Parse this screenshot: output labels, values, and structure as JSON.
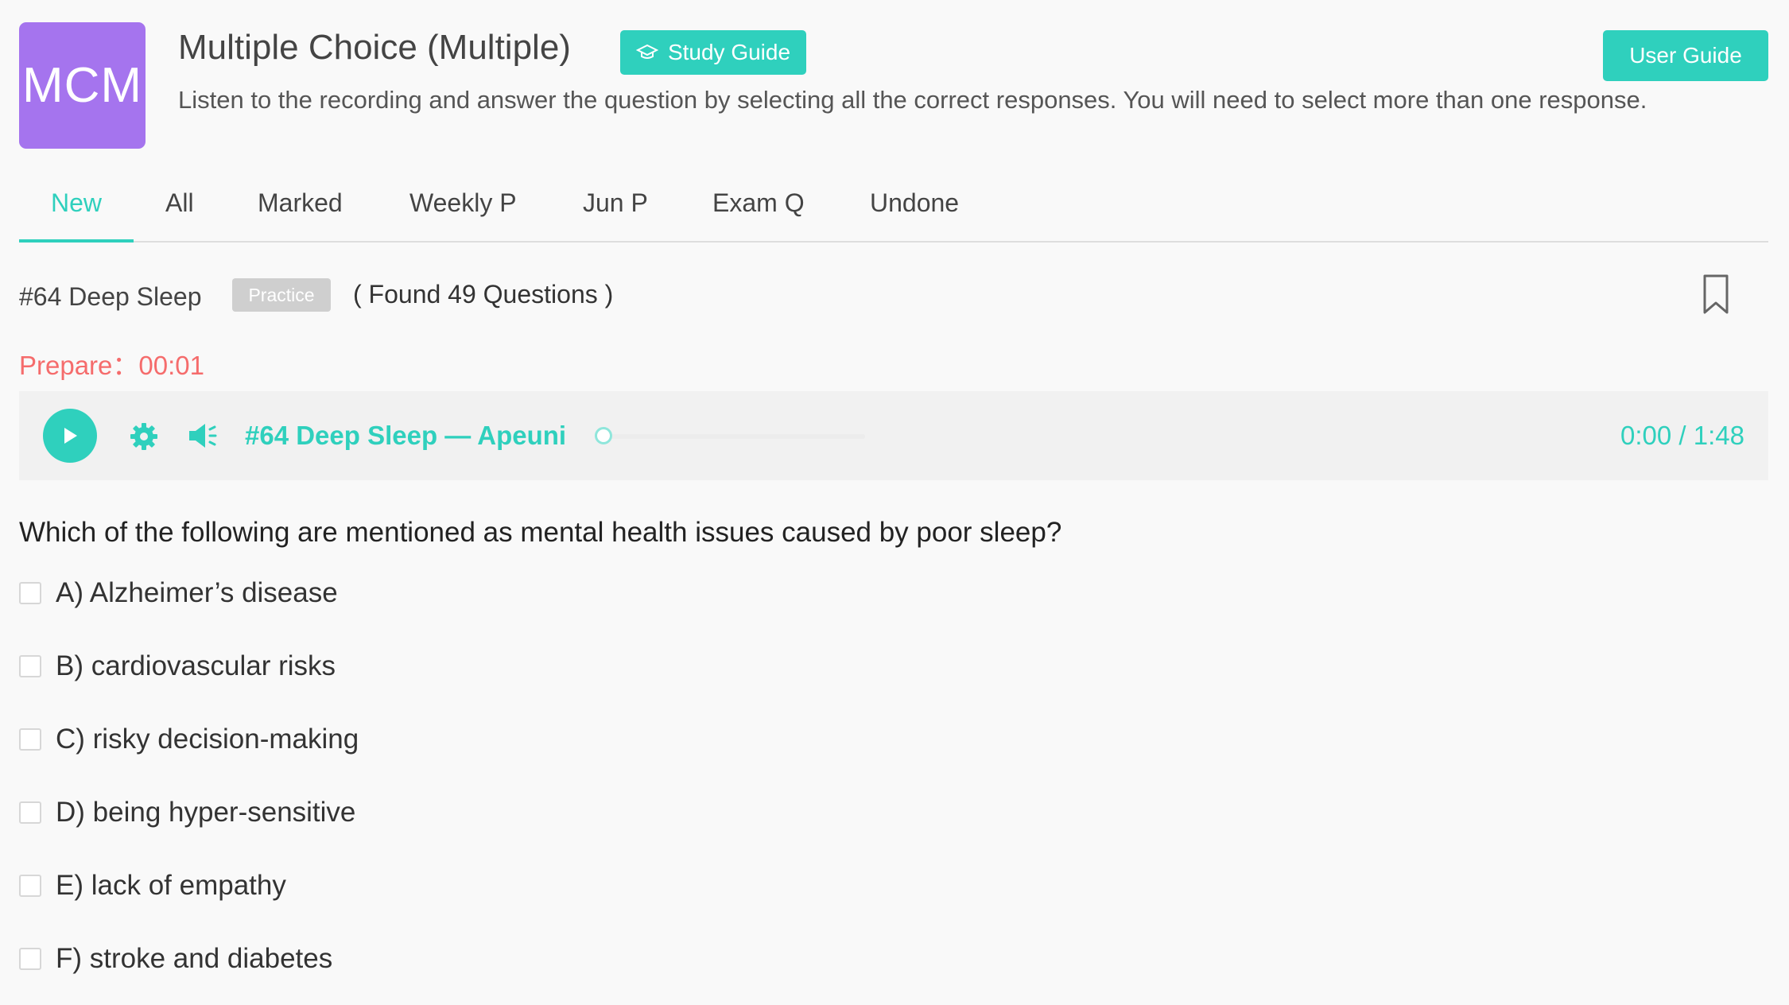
{
  "logo": {
    "text": "MCM"
  },
  "header": {
    "title": "Multiple Choice (Multiple)",
    "study_guide_label": "Study Guide",
    "user_guide_label": "User Guide",
    "description": "Listen to the recording and answer the question by selecting all the correct responses. You will need to select more than one response."
  },
  "tabs": [
    "New",
    "All",
    "Marked",
    "Weekly P",
    "Jun P",
    "Exam Q",
    "Undone"
  ],
  "active_tab": "New",
  "question_header": {
    "title": "#64 Deep Sleep",
    "badge": "Practice",
    "found": "( Found 49 Questions )"
  },
  "prepare": {
    "label": "Prepare：",
    "time": "00:01"
  },
  "player": {
    "track_title": "#64 Deep Sleep — Apeuni",
    "time": "0:00 / 1:48",
    "progress": 0
  },
  "question": "Which of the following are mentioned as mental health issues caused by poor sleep?",
  "options": [
    "A) Alzheimer’s disease",
    "B) cardiovascular risks",
    "C) risky decision-making",
    "D) being hyper-sensitive",
    "E) lack of empathy",
    "F) stroke and diabetes"
  ],
  "colors": {
    "accent": "#2fd0bd",
    "logo_bg": "#a574ee",
    "prepare": "#f56c6c",
    "badge_bg": "#cfcfcf"
  },
  "icons": {
    "study_guide": "graduation-cap-icon",
    "bookmark": "bookmark-icon",
    "play": "play-icon",
    "settings": "gear-icon",
    "volume": "speaker-icon"
  }
}
